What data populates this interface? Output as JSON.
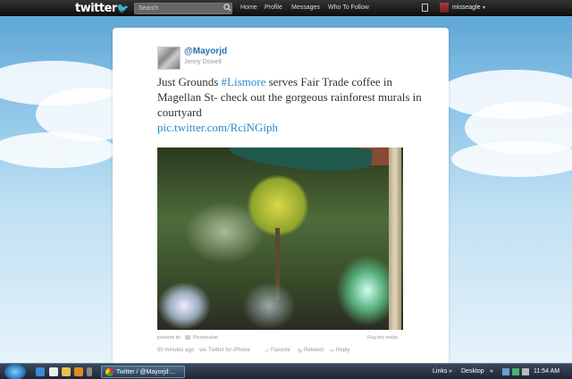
{
  "topbar": {
    "logo_text": "twitter",
    "search_placeholder": "Search",
    "nav": [
      "Home",
      "Profile",
      "Messages",
      "Who To Follow"
    ],
    "username": "misseagle",
    "caret": "▾"
  },
  "tweet": {
    "handle": "@Mayorjd",
    "name": "Jenny Dowell",
    "text_before": "Just Grounds ",
    "hashtag": "#Lismore",
    "text_after": " serves Fair Trade coffee in Magellan St- check out the gorgeous rainforest murals in courtyard",
    "link": "pic.twitter.com/RciNGiph",
    "powered_by": "powered by",
    "photo_service": "Photobucket",
    "flag": "Flag this media",
    "time": "50 minutes ago",
    "via": "via",
    "client": "Twitter for iPhone",
    "actions": {
      "favorite": "Favorite",
      "retweet": "Retweet",
      "reply": "Reply"
    }
  },
  "taskbar": {
    "task_label": "Twitter / @Mayorjd:...",
    "links": "Links",
    "desktop": "Desktop",
    "clock": "11:54 AM"
  },
  "colors": {
    "link_blue": "#2a8bc7",
    "handle_blue": "#2a6fb0",
    "topbar": "#1a1a1a"
  }
}
